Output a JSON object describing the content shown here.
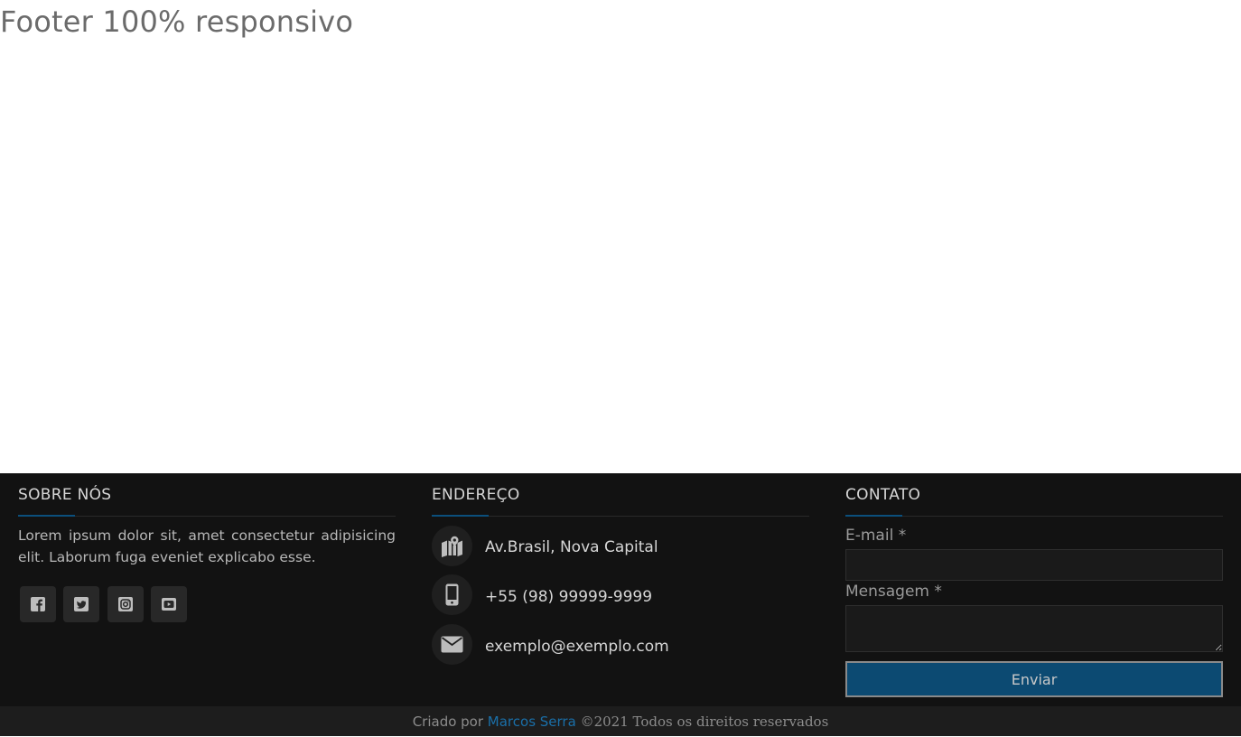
{
  "page": {
    "title": "Footer 100% responsivo"
  },
  "theme": {
    "footer_bg": "#121212",
    "bottom_bar_bg": "#1d1d1d",
    "accent": "#0b4f7c",
    "link": "#1a6fa8",
    "button_bg": "#0c4a72"
  },
  "about": {
    "heading": "SOBRE NÓS",
    "text": "Lorem ipsum dolor sit, amet consectetur adipisicing elit. Laborum fuga eveniet explicabo esse.",
    "social": [
      {
        "name": "facebook",
        "icon": "facebook-icon"
      },
      {
        "name": "twitter",
        "icon": "twitter-icon"
      },
      {
        "name": "instagram",
        "icon": "instagram-icon"
      },
      {
        "name": "youtube",
        "icon": "youtube-icon"
      }
    ]
  },
  "address": {
    "heading": "ENDEREÇO",
    "items": [
      {
        "icon": "map-icon",
        "text": "Av.Brasil, Nova Capital"
      },
      {
        "icon": "mobile-phone-icon",
        "text": "+55 (98) 99999-9999"
      },
      {
        "icon": "envelope-icon",
        "text": "exemplo@exemplo.com"
      }
    ]
  },
  "contact": {
    "heading": "CONTATO",
    "email_label": "E-mail *",
    "email_value": "",
    "message_label": "Mensagem *",
    "message_value": "",
    "submit_label": "Enviar"
  },
  "bottom": {
    "prefix": "Criado por ",
    "author": "Marcos Serra",
    "copyright": " ©2021 Todos os direitos reservados"
  }
}
